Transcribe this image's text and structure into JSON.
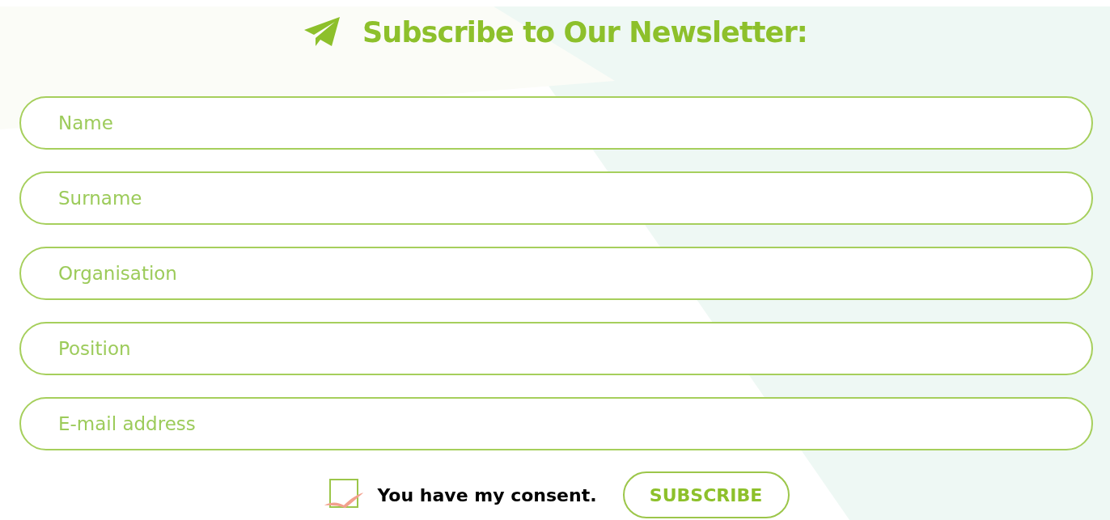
{
  "title": "Subscribe to Our Newsletter:",
  "fields": [
    {
      "placeholder": "Name"
    },
    {
      "placeholder": "Surname"
    },
    {
      "placeholder": "Organisation"
    },
    {
      "placeholder": "Position"
    },
    {
      "placeholder": "E-mail address"
    }
  ],
  "consent": {
    "label": "You have my consent.",
    "checked": true
  },
  "submit_button": "SUBSCRIBE"
}
